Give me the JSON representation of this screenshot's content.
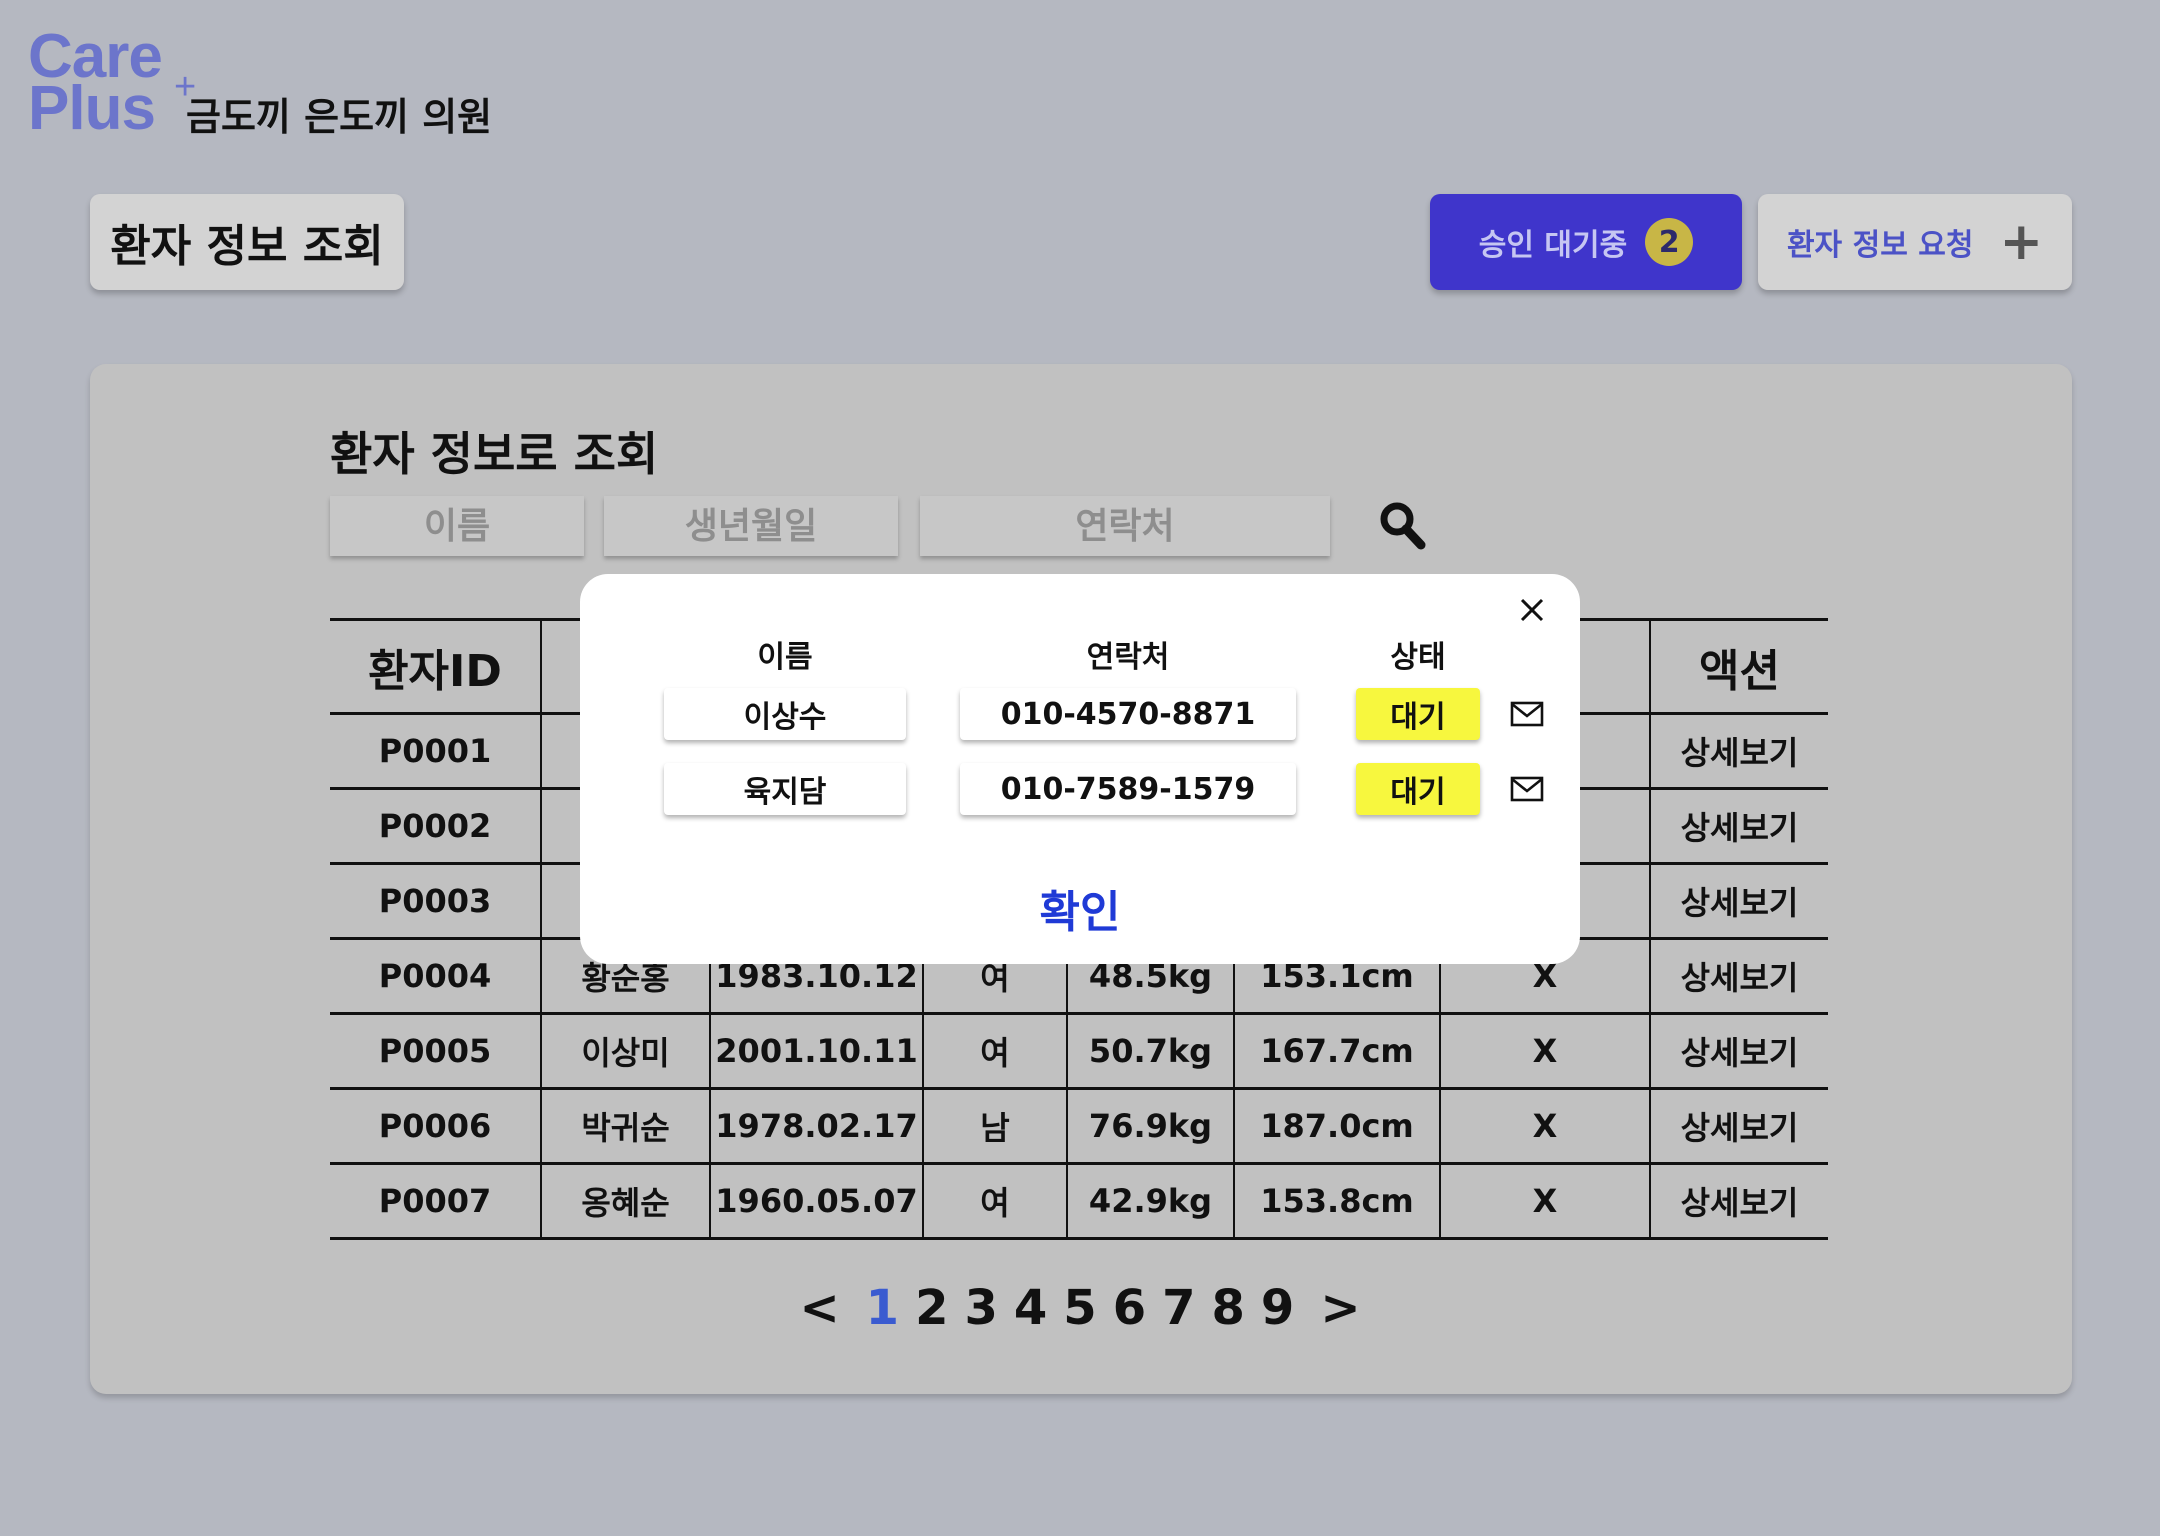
{
  "logo": {
    "line1": "Care",
    "line2": "Plus",
    "sup": "+"
  },
  "clinic_name": "금도끼 은도끼 의원",
  "header": {
    "page_title": "환자 정보 조회",
    "pending_label": "승인 대기중",
    "pending_count": "2",
    "request_label": "환자 정보 요청",
    "request_icon": "plus-icon"
  },
  "search": {
    "title": "환자 정보로 조회",
    "name_placeholder": "이름",
    "birth_placeholder": "생년월일",
    "phone_placeholder": "연락처",
    "icon": "search-icon"
  },
  "table": {
    "columns": [
      "환자ID",
      "",
      "",
      "",
      "",
      "",
      "",
      "액션"
    ],
    "rows": [
      [
        "P0001",
        "",
        "",
        "",
        "",
        "",
        "",
        "상세보기"
      ],
      [
        "P0002",
        "",
        "",
        "",
        "",
        "",
        "",
        "상세보기"
      ],
      [
        "P0003",
        "",
        "",
        "",
        "",
        "",
        "",
        "상세보기"
      ],
      [
        "P0004",
        "황순홍",
        "1983.10.12",
        "여",
        "48.5kg",
        "153.1cm",
        "X",
        "상세보기"
      ],
      [
        "P0005",
        "이상미",
        "2001.10.11",
        "여",
        "50.7kg",
        "167.7cm",
        "X",
        "상세보기"
      ],
      [
        "P0006",
        "박귀순",
        "1978.02.17",
        "남",
        "76.9kg",
        "187.0cm",
        "X",
        "상세보기"
      ],
      [
        "P0007",
        "옹혜순",
        "1960.05.07",
        "여",
        "42.9kg",
        "153.8cm",
        "X",
        "상세보기"
      ]
    ]
  },
  "pagination": {
    "prev": "<",
    "pages": [
      "1",
      "2",
      "3",
      "4",
      "5",
      "6",
      "7",
      "8",
      "9"
    ],
    "current": "1",
    "next": ">"
  },
  "modal": {
    "headers": {
      "name": "이름",
      "phone": "연락처",
      "status": "상태"
    },
    "rows": [
      {
        "name": "이상수",
        "phone": "010-4570-8871",
        "status": "대기"
      },
      {
        "name": "육지담",
        "phone": "010-7589-1579",
        "status": "대기"
      }
    ],
    "confirm_label": "확인",
    "close_icon": "close-icon",
    "mail_icon": "mail-icon"
  },
  "colors": {
    "background": "#b5b8c1",
    "brand": "#6c75cb",
    "primary_button": "#3f35cb",
    "badge": "#c8b646",
    "status_waiting": "#f7f73e",
    "confirm": "#1f3ad6",
    "current_page": "#3a5bd0"
  }
}
